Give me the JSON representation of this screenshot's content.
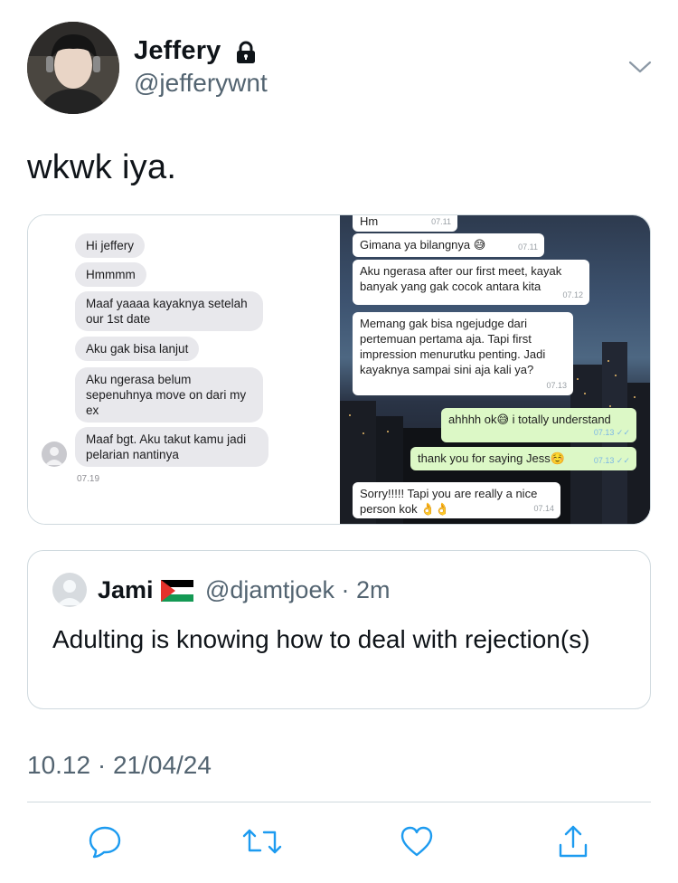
{
  "author": {
    "name": "Jeffery",
    "handle": "@jefferywnt"
  },
  "tweet": {
    "text": "wkwk iya."
  },
  "left_chat": {
    "messages": [
      "Hi jeffery",
      "Hmmmm",
      "Maaf yaaaa kayaknya setelah our 1st date",
      "Aku gak bisa lanjut",
      "Aku ngerasa belum sepenuhnya move on dari my ex",
      "Maaf bgt. Aku takut kamu jadi pelarian nantinya"
    ],
    "time": "07.19"
  },
  "right_chat": {
    "messages": [
      {
        "text": "Hm",
        "time": "07.11",
        "dir": "in"
      },
      {
        "text": "Gimana ya bilangnya 😅",
        "time": "07.11",
        "dir": "in"
      },
      {
        "text": "Aku ngerasa after our first meet, kayak banyak yang gak cocok antara kita",
        "time": "07.12",
        "dir": "in"
      },
      {
        "text": "Memang gak bisa ngejudge dari pertemuan pertama aja. Tapi first impression menurutku penting. Jadi kayaknya sampai sini aja kali ya?",
        "time": "07.13",
        "dir": "in"
      },
      {
        "text": "ahhhh ok😅 i totally understand",
        "time": "07.13 ✓✓",
        "dir": "out"
      },
      {
        "text": "thank you for saying Jess☺️",
        "time": "07.13 ✓✓",
        "dir": "out"
      },
      {
        "text": "Sorry!!!!! Tapi you are really a nice person kok 👌👌",
        "time": "07.14",
        "dir": "in"
      }
    ]
  },
  "quote": {
    "name": "Jami",
    "flag": "🇵🇸",
    "handle_time": "@djamtjoek · 2m",
    "text": "Adulting is knowing how to deal with rejection(s)"
  },
  "timestamp": "10.12 · 21/04/24",
  "actions": {
    "reply": "reply-icon",
    "retweet": "retweet-icon",
    "like": "heart-icon",
    "share": "share-icon"
  },
  "colors": {
    "text": "#0f1419",
    "secondary": "#536471",
    "border": "#cfd9de",
    "bubble_out": "#dcf8c6",
    "bubble_in_left": "#e8e8ec"
  }
}
